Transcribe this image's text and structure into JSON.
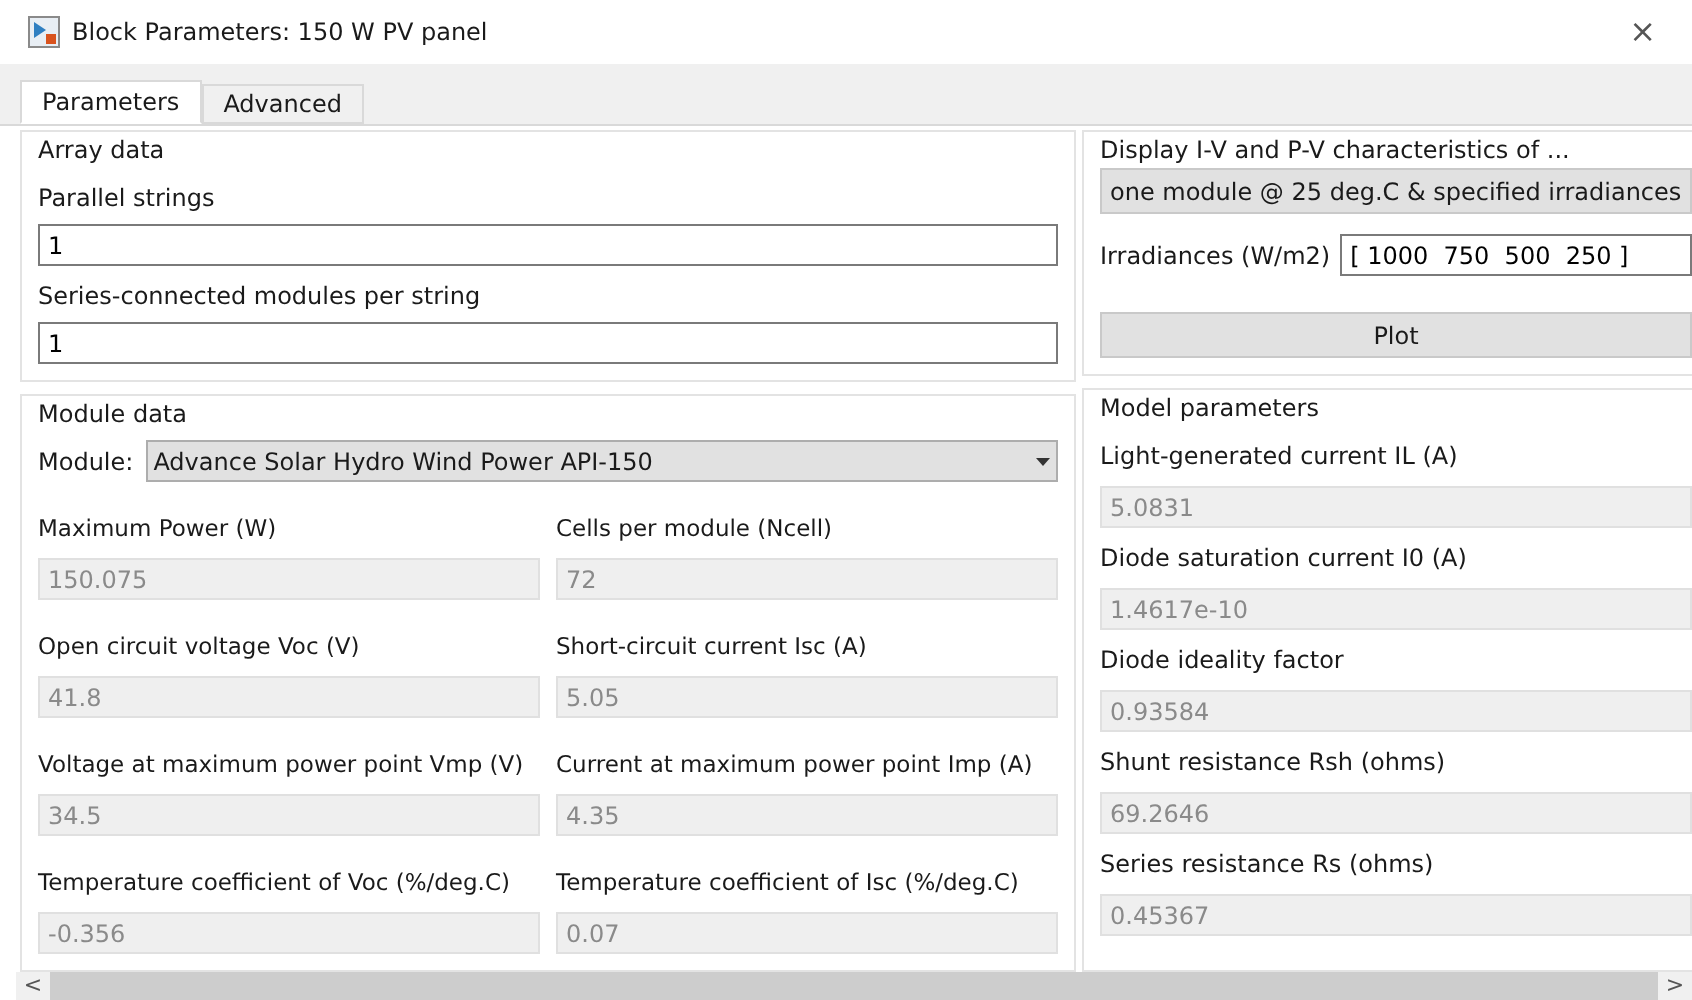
{
  "window": {
    "title": "Block Parameters: 150 W PV panel",
    "close": "×"
  },
  "tabs": [
    {
      "label": "Parameters",
      "selected": true
    },
    {
      "label": "Advanced",
      "selected": false
    }
  ],
  "array_data": {
    "title": "Array data",
    "fields": [
      {
        "label": "Parallel strings",
        "value": "1"
      },
      {
        "label": "Series-connected modules per string",
        "value": "1"
      }
    ]
  },
  "display": {
    "title": "Display  I-V and P-V characteristics of ...",
    "selection": "one module @ 25 deg.C & specified irradiances",
    "irradiances_label": "Irradiances (W/m2)",
    "irradiances_value": "[ 1000  750  500  250 ]",
    "button": "Plot"
  },
  "module_data": {
    "title": "Module data",
    "module_label": "Module:",
    "module_value": "Advance Solar Hydro Wind Power API-150",
    "fields": [
      {
        "label": "Maximum Power (W)",
        "value": "150.075",
        "disabled": true
      },
      {
        "label": "Cells per module (Ncell)",
        "value": "72",
        "disabled": true
      },
      {
        "label": "Open circuit voltage  Voc (V)",
        "value": "41.8",
        "disabled": true
      },
      {
        "label": "Short-circuit current Isc (A)",
        "value": "5.05",
        "disabled": true
      },
      {
        "label": "Voltage at maximum power point Vmp (V)",
        "value": "34.5",
        "disabled": true
      },
      {
        "label": "Current at maximum power point Imp (A)",
        "value": "4.35",
        "disabled": true
      },
      {
        "label": "Temperature coefficient of Voc (%/deg.C)",
        "value": "-0.356",
        "disabled": true
      },
      {
        "label": "Temperature coefficient of Isc (%/deg.C)",
        "value": "0.07",
        "disabled": true
      }
    ]
  },
  "model_parameters": {
    "title": "Model parameters",
    "fields": [
      {
        "label": "Light-generated current IL (A)",
        "value": "5.0831",
        "disabled": true
      },
      {
        "label": "Diode saturation current I0 (A)",
        "value": "1.4617e-10",
        "disabled": true
      },
      {
        "label": "Diode ideality factor",
        "value": "0.93584",
        "disabled": true
      },
      {
        "label": "Shunt resistance Rsh (ohms)",
        "value": "69.2646",
        "disabled": true
      },
      {
        "label": "Series resistance Rs (ohms)",
        "value": "0.45367",
        "disabled": true
      }
    ]
  },
  "scrollbar": {
    "left": "<",
    "right": ">"
  }
}
